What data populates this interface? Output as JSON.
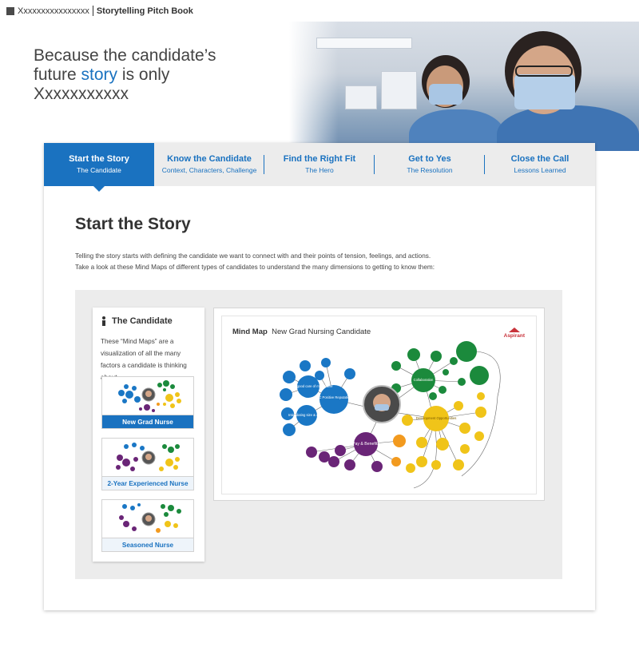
{
  "brand": {
    "client": "Xxxxxxxxxxxxxxxx",
    "product": "Storytelling Pitch Book"
  },
  "hero": {
    "line1": "Because the candidate’s",
    "line2_prefix": "future ",
    "line2_accent": "story",
    "line2_suffix": " is only",
    "line3": "Xxxxxxxxxxx"
  },
  "tabs": [
    {
      "title": "Start the Story",
      "subtitle": "The Candidate",
      "active": true
    },
    {
      "title": "Know the Candidate",
      "subtitle": "Context, Characters, Challenge",
      "active": false
    },
    {
      "title": "Find the Right Fit",
      "subtitle": "The Hero",
      "active": false
    },
    {
      "title": "Get to Yes",
      "subtitle": "The Resolution",
      "active": false
    },
    {
      "title": "Close the Call",
      "subtitle": "Lessons Learned",
      "active": false
    }
  ],
  "section": {
    "title": "Start the Story",
    "intro_line1": "Telling the story starts with defining the candidate we want to connect with and their points of tension, feelings, and actions.",
    "intro_line2": "Take a look at these Mind Maps of different types of candidates to understand the many dimensions to getting to know them:"
  },
  "sidebar": {
    "heading": "The Candidate",
    "description": "These “Mind Maps” are a visualization of all the many factors a candidate is thinking about.",
    "candidates": [
      {
        "label": "New Grad Nurse",
        "active": true
      },
      {
        "label": "2-Year Experienced Nurse",
        "active": false
      },
      {
        "label": "Seasoned Nurse",
        "active": false
      }
    ]
  },
  "mindmap": {
    "title_bold": "Mind Map",
    "title_rest": "New Grad Nursing Candidate",
    "logo_text": "Aspirant",
    "nodes": {
      "reputation": "CC Positive Reputation",
      "pay": "Pay & Benefits",
      "collaboration": "Collaboration",
      "development": "Development Opportunities",
      "good_care": "CC took good care of my relative",
      "intimidating": "Intimidating size & acuity"
    }
  },
  "colors": {
    "accent": "#1a72c0",
    "tab_bg": "#ececec",
    "blue_node": "#1a77c5",
    "green_node": "#1b8a3c",
    "yellow_node": "#f0c419",
    "purple_node": "#6a2577",
    "orange_node": "#f29a1f"
  }
}
